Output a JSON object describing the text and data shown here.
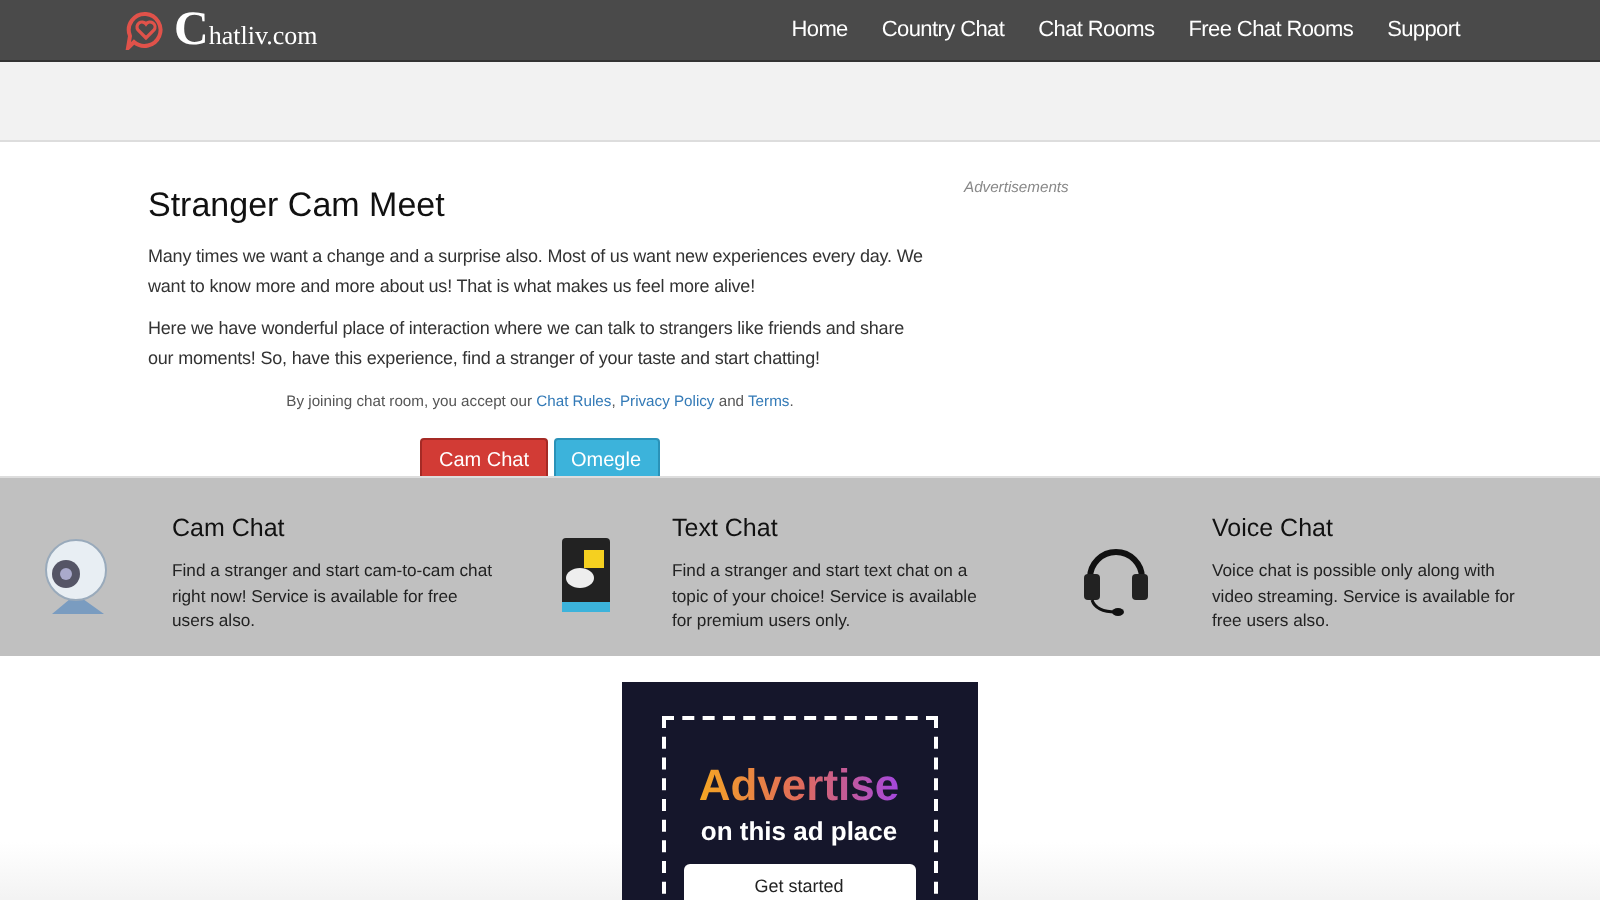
{
  "logo": {
    "text": "Chatliv.com"
  },
  "nav": [
    "Home",
    "Country Chat",
    "Chat Rooms",
    "Free Chat Rooms",
    "Support"
  ],
  "main": {
    "title": "Stranger Cam Meet",
    "paragraphs": [
      "Many times we want a change and a surprise also. Most of us want new experiences every day. We want to know more and more about us! That is what makes us feel more alive!",
      "Here we have wonderful place of interaction where we can talk to strangers like friends and share our moments! So, have this experience, find a stranger of your taste and start chatting!"
    ],
    "terms": {
      "before": "By joining chat room, you accept our",
      "link1": "Chat Rules",
      "sep": ",",
      "link2": "Privacy Policy",
      "and": "and",
      "link3": "Terms",
      "end": "."
    },
    "buttons": [
      {
        "label": "Cam Chat",
        "kind": "danger"
      },
      {
        "label": "Omegle",
        "kind": "info"
      }
    ]
  },
  "ads_label": "Advertisements",
  "features": [
    {
      "kind": "webcam",
      "title": "Cam Chat",
      "text": "Find a stranger and start cam-to-cam chat right now! Service is available for free users also."
    },
    {
      "kind": "folder",
      "title": "Text Chat",
      "text": "Find a stranger and start text chat on a topic of your choice! Service is available for premium users only."
    },
    {
      "kind": "headset",
      "title": "Voice Chat",
      "text": "Voice chat is possible only along with video streaming. Service is available for free users also."
    }
  ],
  "ad": {
    "headline": "Advertise",
    "subline": "on this ad place",
    "button": "Get started"
  }
}
